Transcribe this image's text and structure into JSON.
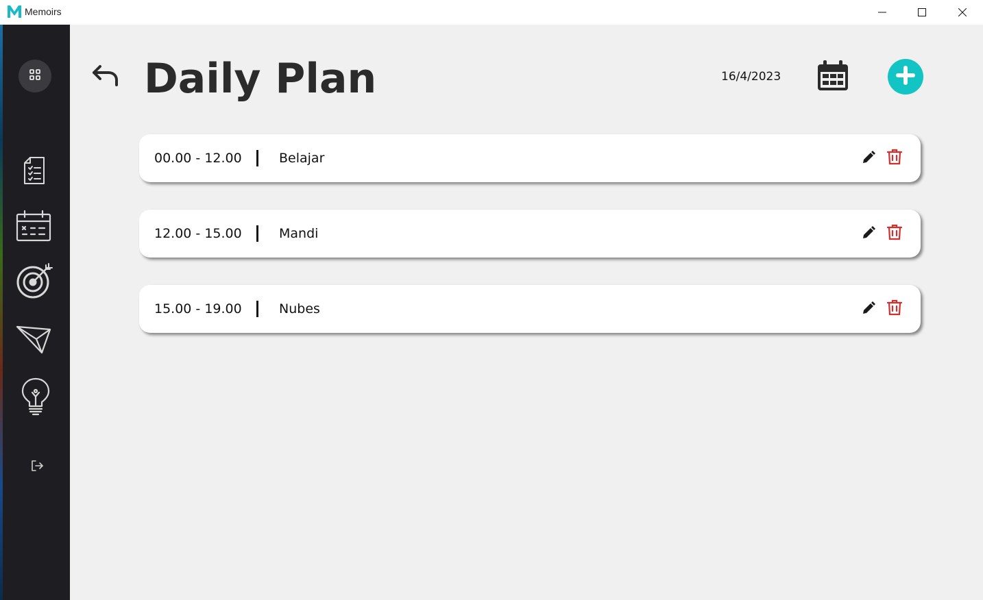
{
  "window": {
    "title": "Memoirs",
    "logo_letter": "M",
    "logo_color": "#18b9c9"
  },
  "sidebar": {
    "items": [
      {
        "name": "dashboard",
        "icon": "grid-icon"
      },
      {
        "name": "notes",
        "icon": "checklist-document-icon"
      },
      {
        "name": "daily-plan",
        "icon": "calendar-icon"
      },
      {
        "name": "goals",
        "icon": "target-icon"
      },
      {
        "name": "messages",
        "icon": "paper-plane-icon"
      },
      {
        "name": "ideas",
        "icon": "lightbulb-icon"
      },
      {
        "name": "logout",
        "icon": "logout-icon"
      }
    ]
  },
  "header": {
    "title": "Daily Plan",
    "date": "16/4/2023"
  },
  "plans": [
    {
      "time": "00.00 - 12.00",
      "separator": "|",
      "name": "Belajar"
    },
    {
      "time": "12.00 - 15.00",
      "separator": "|",
      "name": "Mandi"
    },
    {
      "time": "15.00 - 19.00",
      "separator": "|",
      "name": "Nubes"
    }
  ],
  "colors": {
    "accent": "#13c4c4",
    "sidebar_bg": "#1e1e22",
    "delete": "#d32f2f",
    "text": "#2b2b2b"
  }
}
